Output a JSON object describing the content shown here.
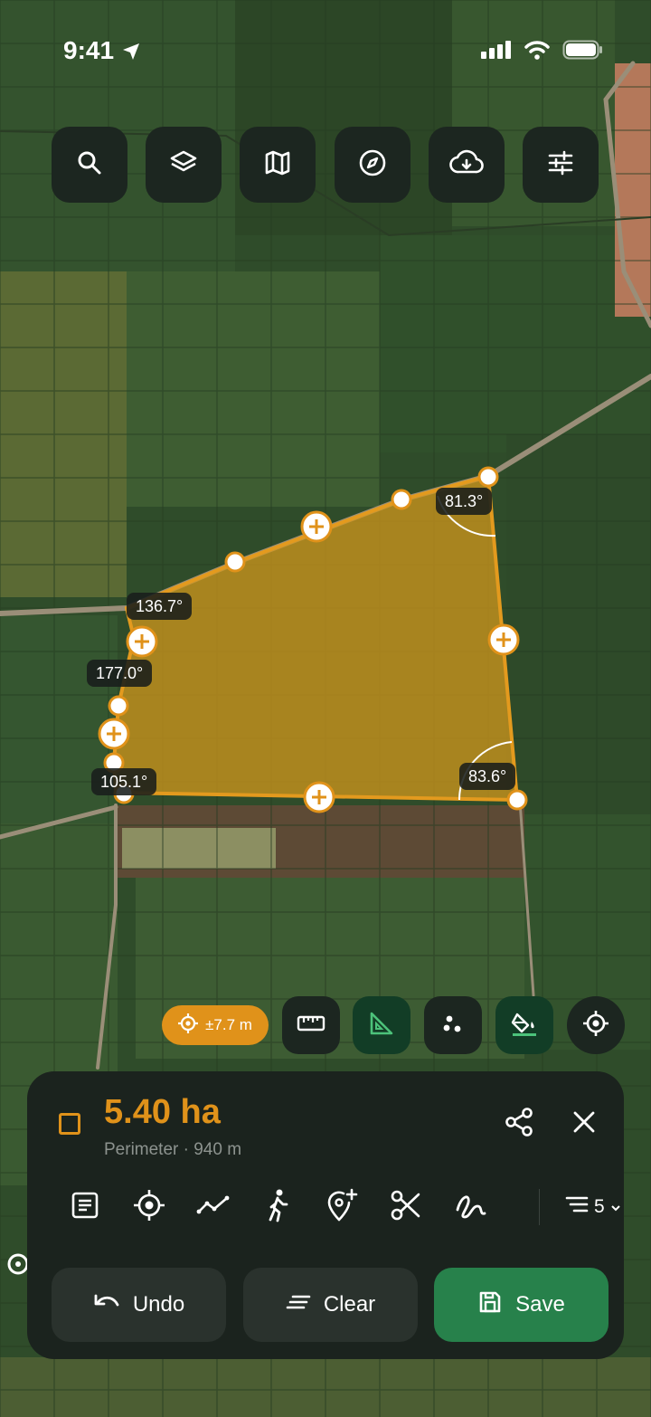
{
  "status_bar": {
    "time": "9:41"
  },
  "toolbar": {
    "buttons": [
      {
        "icon": "search-icon"
      },
      {
        "icon": "layers-icon"
      },
      {
        "icon": "map-icon"
      },
      {
        "icon": "compass-icon"
      },
      {
        "icon": "cloud-download-icon"
      },
      {
        "icon": "sliders-icon"
      }
    ]
  },
  "map": {
    "angles": [
      "136.7°",
      "177.0°",
      "105.1°",
      "81.3°",
      "83.6°"
    ],
    "polygon_fill": "#d79a1c",
    "accent": "#e0921a"
  },
  "map_controls": {
    "accuracy": "±7.7 m"
  },
  "sheet": {
    "area": "5.40 ha",
    "perimeter": "Perimeter · 940 m",
    "layers_count": "5",
    "undo_label": "Undo",
    "clear_label": "Clear",
    "save_label": "Save"
  },
  "colors": {
    "save_green": "#27814b",
    "panel": "#1b231e"
  }
}
